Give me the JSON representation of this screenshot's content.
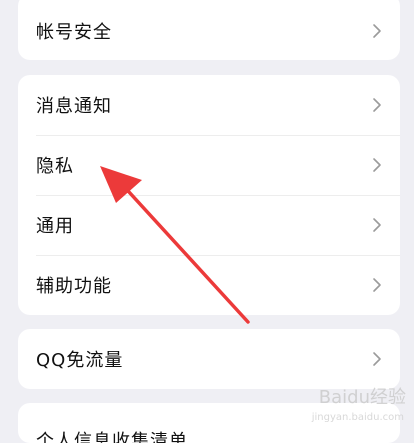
{
  "settings": {
    "account_group": [
      {
        "label": "帐号安全"
      }
    ],
    "main_group": [
      {
        "label": "消息通知"
      },
      {
        "label": "隐私"
      },
      {
        "label": "通用"
      },
      {
        "label": "辅助功能"
      }
    ],
    "traffic_group": [
      {
        "label": "QQ免流量"
      }
    ],
    "info_group": [
      {
        "label": "个人信息收集清单"
      }
    ]
  },
  "annotation": {
    "arrow_color": "#ec3a3a",
    "target": "隐私"
  },
  "watermark": {
    "brand": "Baidu经验",
    "url": "jingyan.baidu.com"
  },
  "colors": {
    "background": "#efeff4",
    "card": "#ffffff",
    "chevron": "#9b9b9b",
    "text": "#111111"
  }
}
